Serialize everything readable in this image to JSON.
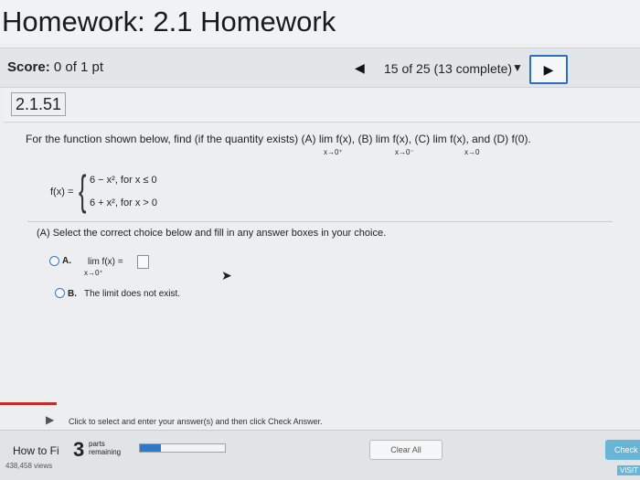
{
  "header": {
    "title": "Homework: 2.1 Homework"
  },
  "scorebar": {
    "score_label": "Score:",
    "score_value": "0 of 1 pt",
    "progress": "15 of 25 (13 complete)",
    "prev_icon": "triangle-left",
    "next_icon": "triangle-right",
    "dropdown_icon": "triangle-down"
  },
  "question": {
    "number": "2.1.51",
    "prompt": "For the function shown below, find (if the quantity exists) (A)  lim  f(x), (B)  lim  f(x), (C) lim f(x), and (D) f(0).",
    "sub_a": "x→0⁺",
    "sub_b": "x→0⁻",
    "sub_c": "x→0",
    "fx_label": "f(x) =",
    "piece1": "6 − x², for x ≤ 0",
    "piece2": "6 + x², for x > 0",
    "part_a": "(A) Select the correct choice below and fill in any answer boxes in your choice.",
    "options": [
      {
        "letter": "A.",
        "text": "lim   f(x) =",
        "sub": "x→0⁺"
      },
      {
        "letter": "B.",
        "text": "The limit does not exist."
      }
    ]
  },
  "hint": "Click to select and enter your answer(s) and then click Check Answer.",
  "footer": {
    "how_to": "How to Fi",
    "views": "438,458 views",
    "parts_num": "3",
    "parts_label_1": "parts",
    "parts_label_2": "remaining",
    "progress_fraction": 0.25,
    "clear_all": "Clear All",
    "check": "Check",
    "visit": "VISIT"
  },
  "colors": {
    "accent": "#2b6fc4",
    "check": "#68b5d8",
    "red": "#c82a2a"
  }
}
